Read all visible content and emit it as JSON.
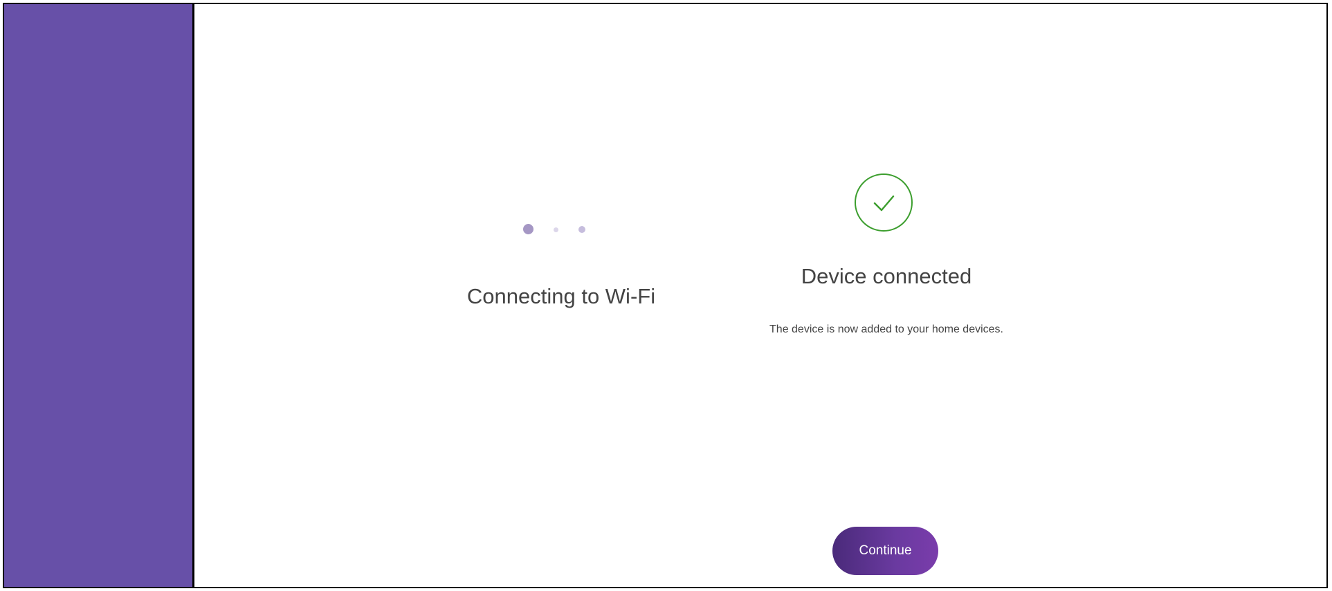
{
  "left_step": {
    "title": "Connecting to Wi-Fi"
  },
  "right_step": {
    "title": "Device connected",
    "description": "The device is now added to your home devices."
  },
  "actions": {
    "continue_label": "Continue"
  },
  "icons": {
    "status": "check-circle-icon",
    "progress": "loading-dots"
  },
  "colors": {
    "sidebar": "#6750a8",
    "accent": "#6a3aa0",
    "success": "#3c9e2e"
  }
}
